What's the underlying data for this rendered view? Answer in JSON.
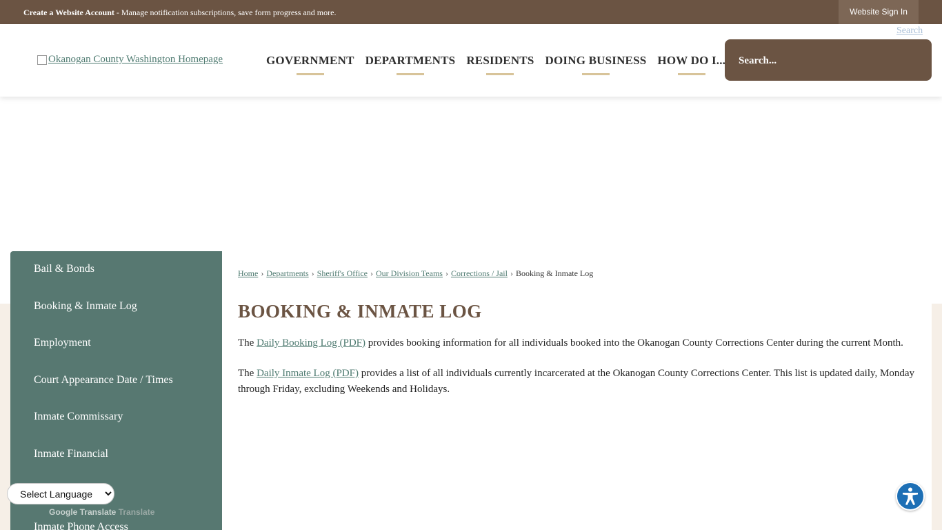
{
  "topbar": {
    "account_link": "Create a Website Account",
    "account_desc": " - Manage notification subscriptions, save form progress and more.",
    "signin": "Website Sign In"
  },
  "header": {
    "logo_alt": "Okanogan County Washington Homepage",
    "nav": [
      "GOVERNMENT",
      "DEPARTMENTS",
      "RESIDENTS",
      "DOING BUSINESS",
      "HOW DO I..."
    ],
    "search_placeholder": "Search...",
    "search_button_alt": "Search"
  },
  "sidebar": {
    "items": [
      "Bail & Bonds",
      "Booking & Inmate Log",
      "Employment",
      "Court Appearance Date / Times",
      "Inmate Commissary",
      "Inmate Financial",
      "Inmate Phone Access"
    ]
  },
  "breadcrumb": {
    "items": [
      "Home",
      "Departments",
      "Sheriff's Office",
      "Our Division Teams",
      "Corrections / Jail"
    ],
    "current": "Booking & Inmate Log",
    "separator": "›"
  },
  "main": {
    "title": "BOOKING & INMATE LOG",
    "p1_pre": "The ",
    "p1_link": "Daily Booking Log (PDF)",
    "p1_post": " provides booking information for all individuals booked into the Okanogan County Corrections Center during the current Month.",
    "p2_pre": "The ",
    "p2_link": "Daily Inmate Log (PDF)",
    "p2_post": " provides a list of all individuals currently incarcerated at the Okanogan County Corrections Center. This list is updated daily, Monday through Friday, excluding Weekends and Holidays."
  },
  "translate": {
    "select_label": "Select Language",
    "powered": "Google Translate",
    "word": "Translate"
  },
  "colors": {
    "brown": "#6b5443",
    "teal": "#577871",
    "gold": "#d8c49a",
    "beige": "#f6efe7",
    "a11y_blue": "#1d6fb5"
  },
  "icons": {
    "accessibility": "accessibility-icon",
    "search": "search-icon"
  }
}
